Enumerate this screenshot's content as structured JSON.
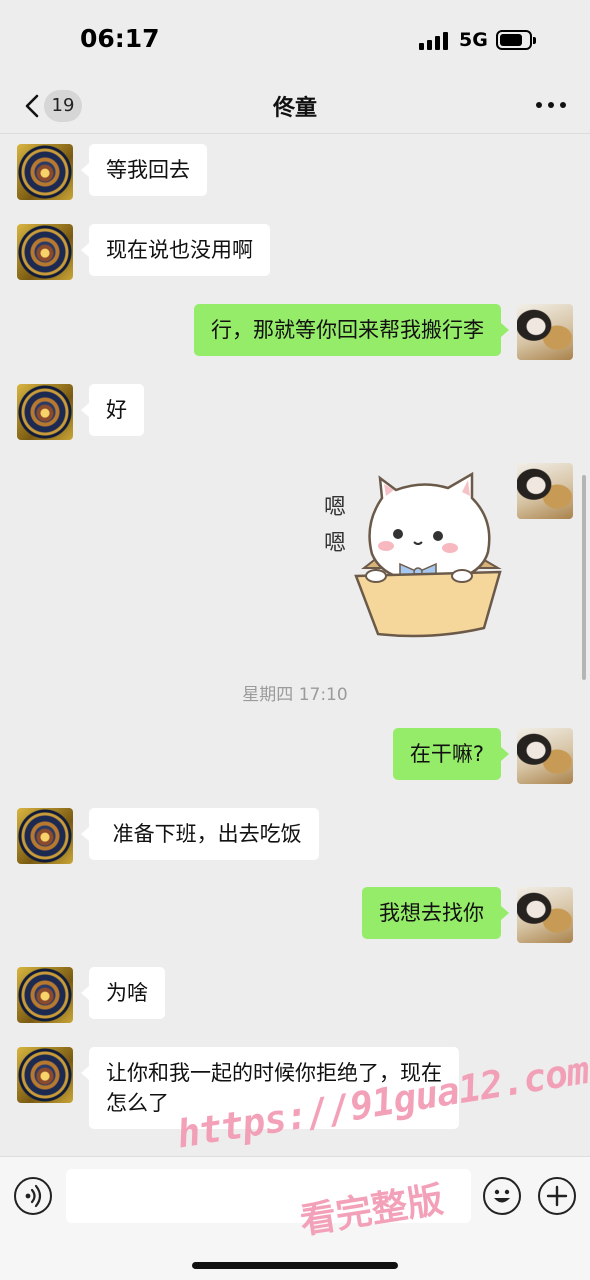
{
  "status_bar": {
    "time": "06:17",
    "network": "5G"
  },
  "nav": {
    "back_count": "19",
    "title": "佟童"
  },
  "messages": [
    {
      "side": "left",
      "text": "等我回去"
    },
    {
      "side": "left",
      "text": "现在说也没用啊"
    },
    {
      "side": "right",
      "text": "行，那就等你回来帮我搬行李"
    },
    {
      "side": "left",
      "text": "好"
    },
    {
      "side": "right",
      "type": "sticker",
      "sticker_text": [
        "嗯",
        "嗯"
      ]
    },
    {
      "type": "timestamp",
      "text": "星期四 17:10"
    },
    {
      "side": "right",
      "text": "在干嘛?"
    },
    {
      "side": "left",
      "text": " 准备下班，出去吃饭"
    },
    {
      "side": "right",
      "text": "我想去找你"
    },
    {
      "side": "left",
      "text": "为啥"
    },
    {
      "side": "left",
      "text_lines": [
        "让你和我一起的时候你拒绝了，现在",
        "怎么了"
      ]
    }
  ],
  "input_bar": {
    "voice_icon": "voice-icon",
    "emoji_icon": "emoji-icon",
    "plus_icon": "plus-icon",
    "input_value": ""
  },
  "watermark": {
    "line1": "https://91gua12.com",
    "line2": "看完整版"
  },
  "colors": {
    "background": "#ededed",
    "bubble_self": "#95ec69",
    "bubble_other": "#ffffff",
    "watermark": "#f39ab3"
  }
}
